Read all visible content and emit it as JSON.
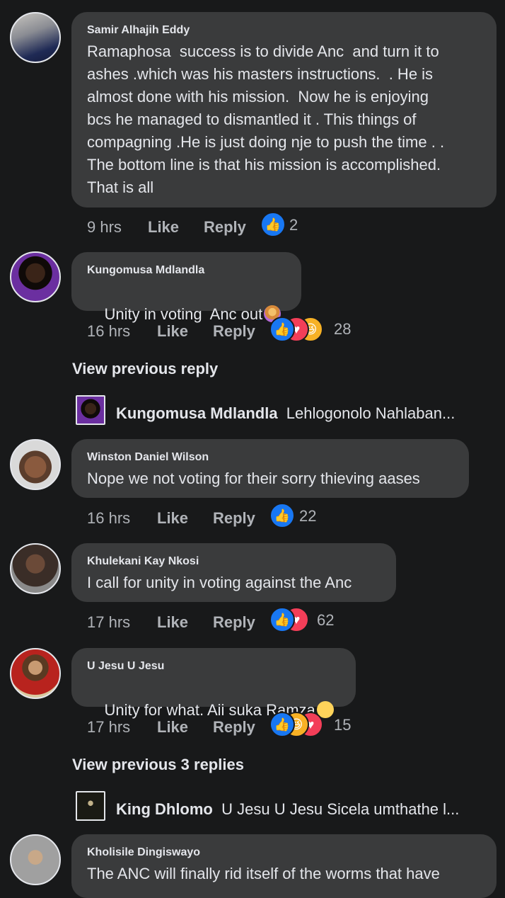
{
  "comments": [
    {
      "author": "Samir Alhajih Eddy",
      "text": "Ramaphosa  success is to divide Anc  and turn it to\nashes .which was his masters instructions.  . He is\nalmost done with his mission.  Now he is enjoying\nbcs he managed to dismantled it . This things of\ncompagning .He is just doing nje to push the time . .\nThe bottom line is that his mission is accomplished.\nThat is all",
      "time": "9 hrs",
      "like": "Like",
      "reply": "Reply",
      "reactions_count": "2"
    },
    {
      "author": "Kungomusa Mdlandla",
      "text": "Unity in voting  Anc out",
      "time": "16 hrs",
      "like": "Like",
      "reply": "Reply",
      "reactions_count": "28"
    },
    {
      "author": "Winston Daniel Wilson",
      "text": "Nope we not voting for their sorry thieving aases",
      "time": "16 hrs",
      "like": "Like",
      "reply": "Reply",
      "reactions_count": "22"
    },
    {
      "author": "Khulekani Kay Nkosi",
      "text": "I call for unity in voting against the Anc",
      "time": "17 hrs",
      "like": "Like",
      "reply": "Reply",
      "reactions_count": "62"
    },
    {
      "author": "U Jesu U Jesu",
      "text": "Unity for what. Aii suka Ramza",
      "time": "17 hrs",
      "like": "Like",
      "reply": "Reply",
      "reactions_count": "15"
    },
    {
      "author": "Kholisile Dingiswayo",
      "text": "The ANC will finally rid itself of the worms that have"
    }
  ],
  "view_previous": [
    "View previous reply",
    "View previous 3 replies"
  ],
  "reply_previews": [
    {
      "author": "Kungomusa Mdlandla",
      "text": "Lehlogonolo Nahlaban..."
    },
    {
      "author": "King Dhlomo",
      "text": "U Jesu U Jesu Sicela umthathe l..."
    }
  ],
  "icons": {
    "like": "thumbs-up-icon",
    "love": "heart-icon",
    "haha": "laughing-face-icon",
    "raising_hand": "person-raising-hand-emoji",
    "eye_roll": "face-with-rolling-eyes-emoji"
  },
  "colors": {
    "background": "#18191a",
    "bubble": "#3a3b3c",
    "like": "#1877f2",
    "love": "#f33e58",
    "haha": "#f7b125"
  }
}
